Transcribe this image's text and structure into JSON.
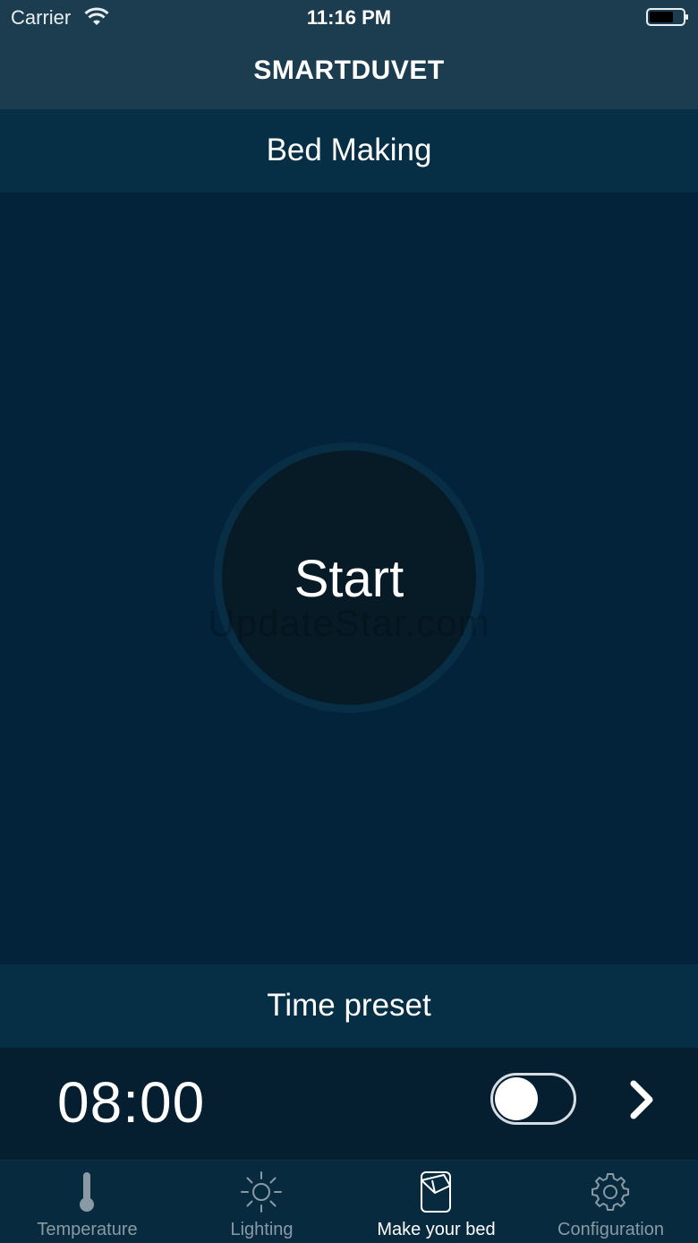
{
  "status_bar": {
    "carrier": "Carrier",
    "time": "11:16 PM",
    "wifi_icon": "wifi-icon",
    "battery_icon": "battery-icon"
  },
  "nav": {
    "title": "SMARTDUVET"
  },
  "bed_making": {
    "title": "Bed Making",
    "start_label": "Start"
  },
  "watermark": "UpdateStar.com",
  "time_preset": {
    "title": "Time preset",
    "time": "08:00",
    "toggle_on": false
  },
  "tabs": [
    {
      "label": "Temperature",
      "icon": "thermometer-icon",
      "active": false
    },
    {
      "label": "Lighting",
      "icon": "sun-icon",
      "active": false
    },
    {
      "label": "Make your bed",
      "icon": "bed-icon",
      "active": true
    },
    {
      "label": "Configuration",
      "icon": "gear-icon",
      "active": false
    }
  ],
  "colors": {
    "background": "#03233a",
    "nav": "#1b3d4f",
    "section_header": "#062f45",
    "active_tab": "#ffffff",
    "inactive_tab": "#8a9aa4"
  }
}
